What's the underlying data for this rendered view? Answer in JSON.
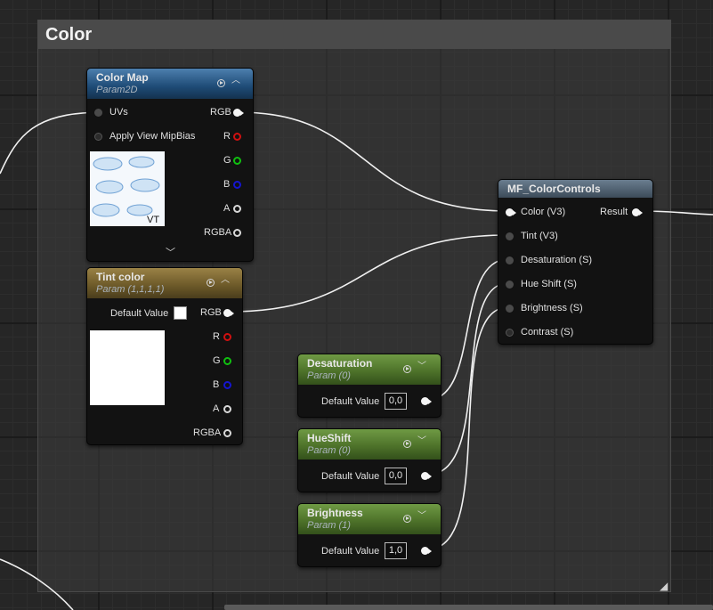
{
  "comment": {
    "title": "Color"
  },
  "nodes": {
    "color_map": {
      "title": "Color Map",
      "subtitle": "Param2D",
      "inputs": [
        "UVs",
        "Apply View MipBias"
      ],
      "outputs": [
        "RGB",
        "R",
        "G",
        "B",
        "A",
        "RGBA"
      ],
      "preview_label": "VT"
    },
    "tint_color": {
      "title": "Tint color",
      "subtitle": "Param (1,1,1,1)",
      "default_label": "Default Value",
      "outputs": [
        "RGB",
        "R",
        "G",
        "B",
        "A",
        "RGBA"
      ]
    },
    "mf_color_controls": {
      "title": "MF_ColorControls",
      "inputs": [
        "Color (V3)",
        "Tint (V3)",
        "Desaturation (S)",
        "Hue Shift (S)",
        "Brightness (S)",
        "Contrast (S)"
      ],
      "output": "Result"
    },
    "desaturation": {
      "title": "Desaturation",
      "subtitle": "Param (0)",
      "default_label": "Default Value",
      "value": "0,0"
    },
    "hueshift": {
      "title": "HueShift",
      "subtitle": "Param (0)",
      "default_label": "Default Value",
      "value": "0,0"
    },
    "brightness": {
      "title": "Brightness",
      "subtitle": "Param (1)",
      "default_label": "Default Value",
      "value": "1,0"
    }
  },
  "colors": {
    "texture_param_header": "#1e4b76",
    "vector_param_header": "#6b5828",
    "scalar_param_header": "#4b6f28",
    "function_header": "#3c4b59",
    "wire": "#f0f0f0",
    "pin_r": "#d01010",
    "pin_g": "#10c010",
    "pin_b": "#1515d0"
  }
}
